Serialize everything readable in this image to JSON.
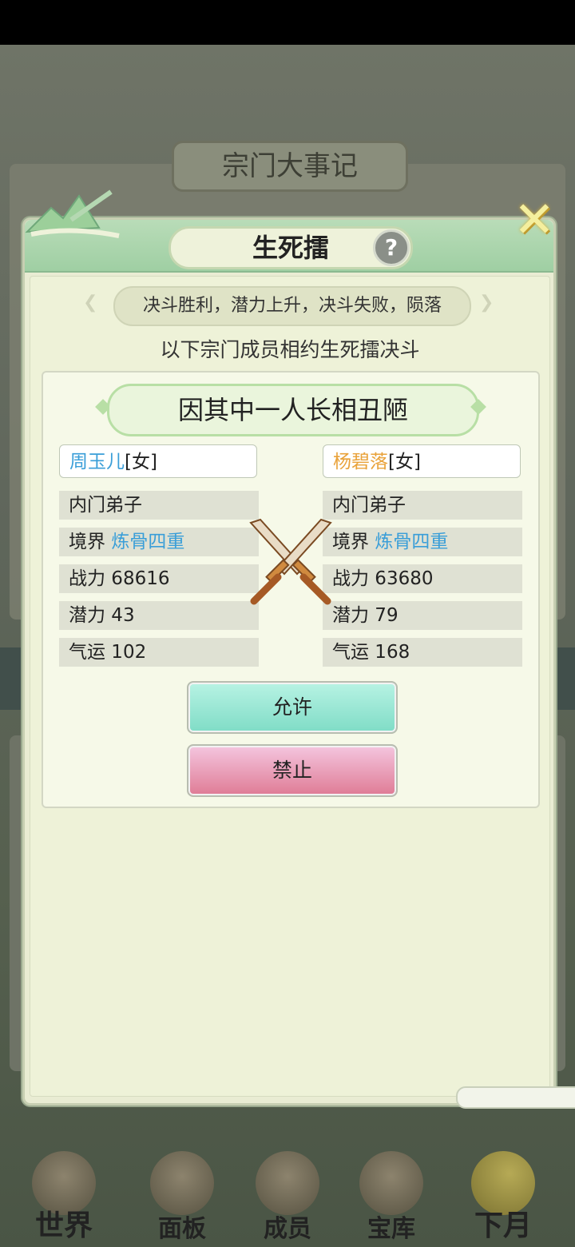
{
  "background": {
    "title": "宗门大事记"
  },
  "dialog": {
    "title": "生死擂",
    "help_icon": "?",
    "close_icon": "✕",
    "rule": "决斗胜利，潜力上升，决斗失败，陨落",
    "intro": "以下宗门成员相约生死擂决斗",
    "reason": "因其中一人长相丑陋",
    "left": {
      "name": "周玉儿",
      "gender": "[女]",
      "rank": "内门弟子",
      "realm_label": "境界",
      "realm_value": "炼骨四重",
      "power": "战力 68616",
      "potential": "潜力 43",
      "luck": "气运 102"
    },
    "right": {
      "name": "杨碧落",
      "gender": "[女]",
      "rank": "内门弟子",
      "realm_label": "境界",
      "realm_value": "炼骨四重",
      "power": "战力 63680",
      "potential": "潜力 79",
      "luck": "气运 168"
    },
    "allow_label": "允许",
    "deny_label": "禁止"
  },
  "nav": {
    "items": [
      {
        "label": "世界",
        "icon": "world-pagoda-icon"
      },
      {
        "label": "面板",
        "icon": "panel-gate-icon"
      },
      {
        "label": "成员",
        "icon": "member-portrait-icon"
      },
      {
        "label": "宝库",
        "icon": "treasury-hall-icon"
      },
      {
        "label": "下月",
        "icon": "moon-icon"
      }
    ]
  },
  "colors": {
    "name_left": "#3a9ed8",
    "name_right": "#e9a23a",
    "realm": "#3a9ed8",
    "allow": "#7fdcc6",
    "deny": "#df7b95"
  }
}
